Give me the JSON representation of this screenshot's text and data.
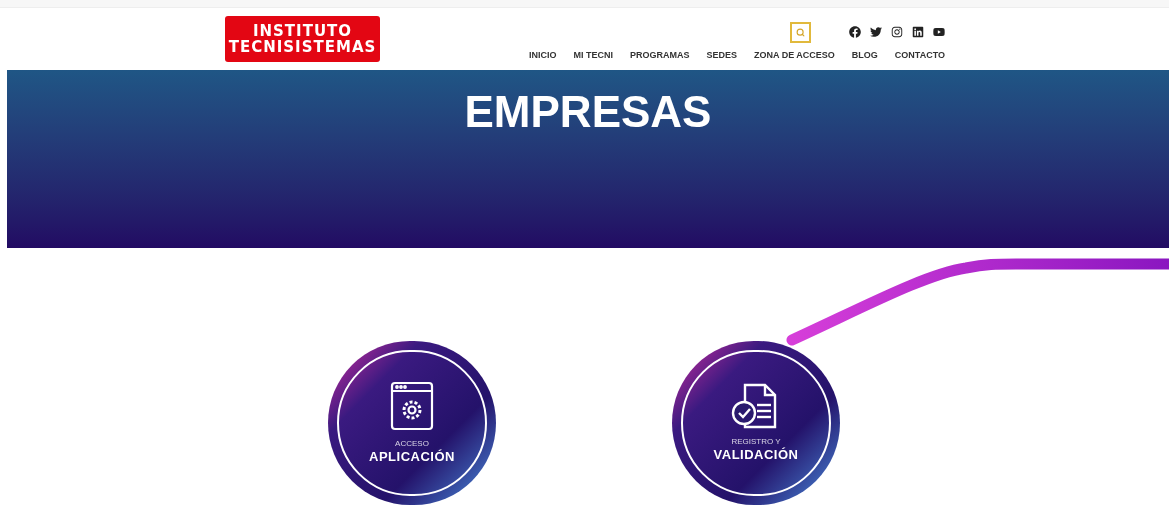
{
  "header": {
    "logo": [
      "INSTITUTO",
      "TECNISISTEMAS"
    ],
    "nav": [
      "INICIO",
      "MI TECNI",
      "PROGRAMAS",
      "SEDES",
      "ZONA DE ACCESO",
      "BLOG",
      "CONTACTO"
    ],
    "social": [
      {
        "kind": "facebook"
      },
      {
        "kind": "twitter"
      },
      {
        "kind": "instagram"
      },
      {
        "kind": "linkedin"
      },
      {
        "kind": "youtube"
      }
    ]
  },
  "banner": {
    "title": "EMPRESAS"
  },
  "cards": [
    {
      "kind": "app",
      "small": "ACCESO",
      "big": "APLICACIÓN"
    },
    {
      "kind": "doc",
      "small": "REGISTRO Y",
      "big": "VALIDACIÓN"
    }
  ]
}
